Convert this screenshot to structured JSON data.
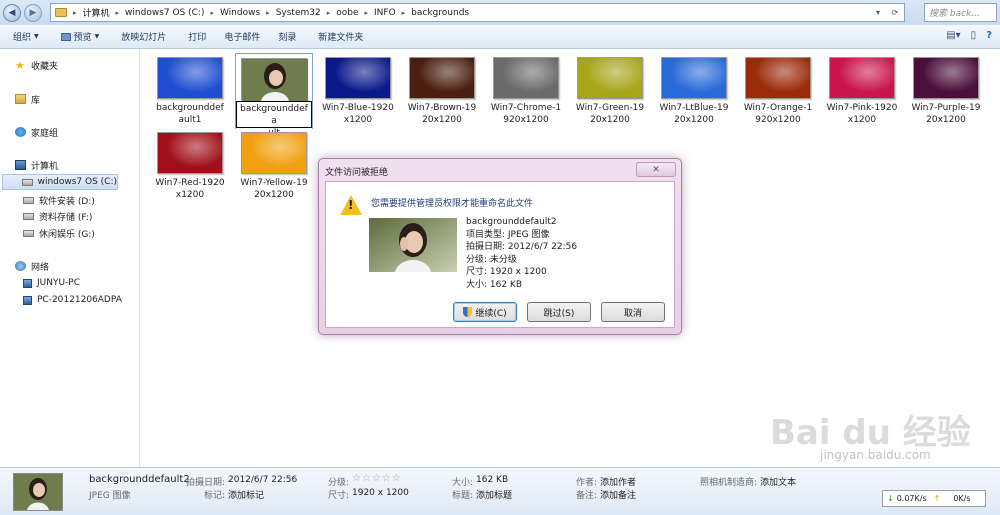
{
  "address_bar": {
    "crumbs": [
      "计算机",
      "windows7 OS (C:)",
      "Windows",
      "System32",
      "oobe",
      "INFO",
      "backgrounds"
    ],
    "search_placeholder": "搜索 back..."
  },
  "toolbar": {
    "organize": "组织",
    "preview": "预览",
    "slideshow": "放映幻灯片",
    "print": "打印",
    "email": "电子邮件",
    "burn": "刻录",
    "new_folder": "新建文件夹"
  },
  "nav": {
    "favorites": "收藏夹",
    "libraries": "库",
    "homegroup": "家庭组",
    "computer": "计算机",
    "drive_c": "windows7 OS (C:)",
    "drive_d": "软件安装 (D:)",
    "drive_f": "资料存储 (F:)",
    "drive_g": "休闲娱乐 (G:)",
    "network": "网络",
    "pc1": "JUNYU-PC",
    "pc2": "PC-20121206ADPA"
  },
  "files": [
    {
      "name": "backgrounddefault1",
      "color": "#1f4fd0"
    },
    {
      "name": "backgrounddefault",
      "color": "photo"
    },
    {
      "name": "Win7-Blue-1920x1200",
      "color": "#0b1a8a"
    },
    {
      "name": "Win7-Brown-1920x1200",
      "color": "#4a1f10"
    },
    {
      "name": "Win7-Chrome-1920x1200",
      "color": "#6a6a6a"
    },
    {
      "name": "Win7-Green-1920x1200",
      "color": "#a6a61a"
    },
    {
      "name": "Win7-LtBlue-1920x1200",
      "color": "#2a6ad8"
    },
    {
      "name": "Win7-Orange-1920x1200",
      "color": "#9a2a0a"
    },
    {
      "name": "Win7-Pink-1920x1200",
      "color": "#c8154e"
    },
    {
      "name": "Win7-Purple-1920x1200",
      "color": "#4a0f3a"
    },
    {
      "name": "Win7-Red-1920x1200",
      "color": "#a0101a"
    },
    {
      "name": "Win7-Yellow-1920x1200",
      "color": "#f0a010"
    }
  ],
  "file_labels": [
    [
      "backgrounddef",
      "ault1"
    ],
    [
      "backgrounddefa",
      "ult"
    ],
    [
      "Win7-Blue-1920",
      "x1200"
    ],
    [
      "Win7-Brown-19",
      "20x1200"
    ],
    [
      "Win7-Chrome-1",
      "920x1200"
    ],
    [
      "Win7-Green-19",
      "20x1200"
    ],
    [
      "Win7-LtBlue-19",
      "20x1200"
    ],
    [
      "Win7-Orange-1",
      "920x1200"
    ],
    [
      "Win7-Pink-1920",
      "x1200"
    ],
    [
      "Win7-Purple-19",
      "20x1200"
    ],
    [
      "Win7-Red-1920",
      "x1200"
    ],
    [
      "Win7-Yellow-19",
      "20x1200"
    ]
  ],
  "dialog": {
    "title": "文件访问被拒绝",
    "close": "✕",
    "message": "您需要提供管理员权限才能重命名此文件",
    "file_name": "backgrounddefault2",
    "type": "项目类型: JPEG 图像",
    "date": "拍摄日期: 2012/6/7 22:56",
    "rating": "分级: 未分级",
    "dimensions": "尺寸: 1920 x 1200",
    "size": "大小: 162 KB",
    "btn_continue": "继续(C)",
    "btn_skip": "跳过(S)",
    "btn_cancel": "取消"
  },
  "details": {
    "name": "backgrounddefault2",
    "type": "JPEG 图像",
    "date_label": "拍摄日期:",
    "date_value": "2012/6/7 22:56",
    "tags_label": "标记:",
    "tags_value": "添加标记",
    "rating_label": "分级:",
    "stars": "☆☆☆☆☆",
    "dims_label": "尺寸:",
    "dims_value": "1920 x 1200",
    "size_label": "大小:",
    "size_value": "162 KB",
    "title_label": "标题:",
    "title_value": "添加标题",
    "author_label": "作者:",
    "author_value": "添加作者",
    "comment_label": "备注:",
    "comment_value": "添加备注",
    "camera_label": "照相机制造商:",
    "camera_value": "添加文本"
  },
  "netspeed": {
    "down": "0.07K/s",
    "up": "0K/s"
  },
  "watermark": {
    "brand": "Bai du 经验",
    "url": "jingyan.baidu.com"
  }
}
